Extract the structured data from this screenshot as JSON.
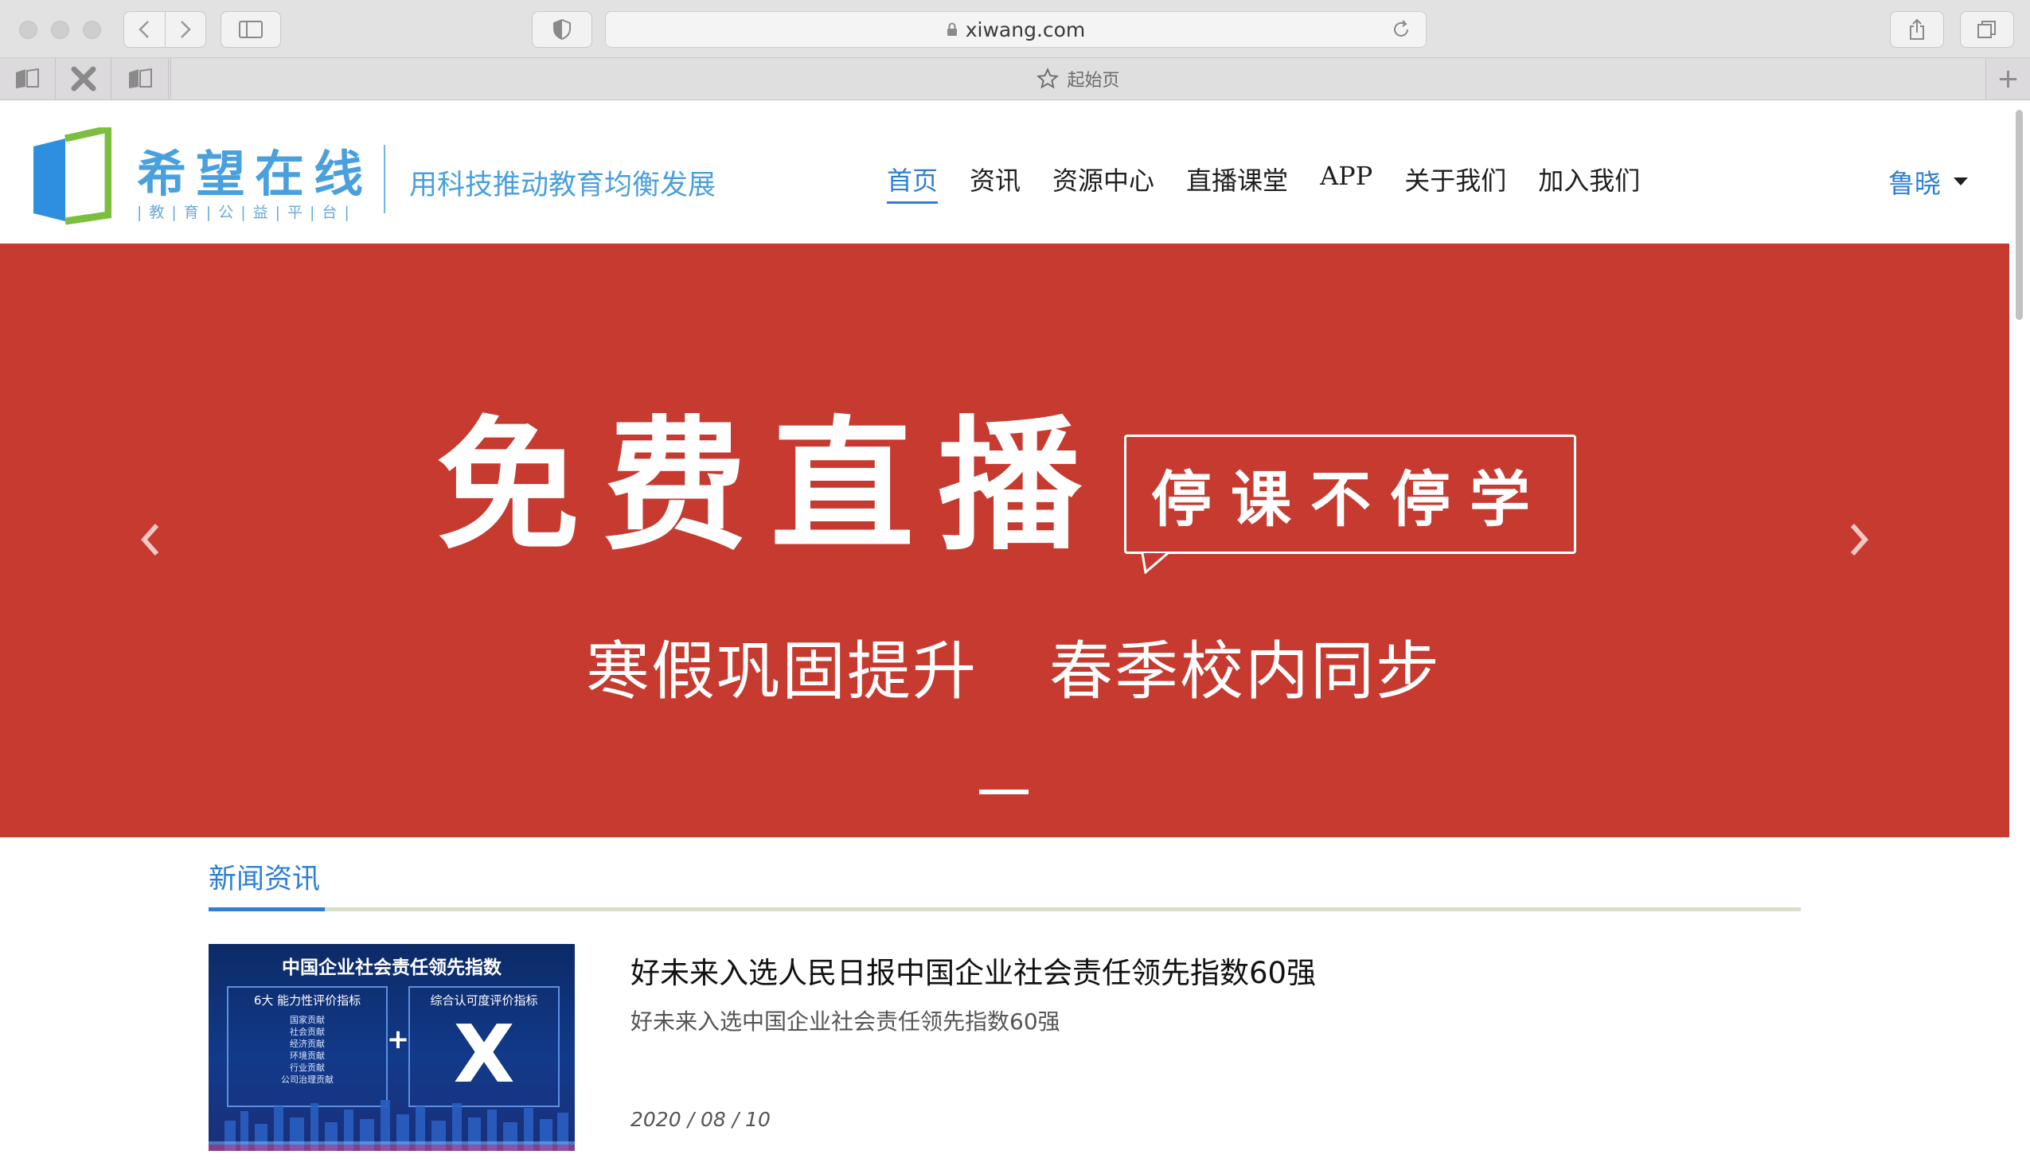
{
  "browser": {
    "address": "xiwang.com",
    "active_tab_title": "起始页",
    "new_tab_symbol": "+"
  },
  "site": {
    "logo_title": "希望在线",
    "logo_subtitle": "|教|育|公|益|平|台|",
    "slogan": "用科技推动教育均衡发展",
    "nav": [
      {
        "label": "首页",
        "active": true
      },
      {
        "label": "资讯",
        "active": false
      },
      {
        "label": "资源中心",
        "active": false
      },
      {
        "label": "直播课堂",
        "active": false
      },
      {
        "label": "APP",
        "active": false
      },
      {
        "label": "关于我们",
        "active": false
      },
      {
        "label": "加入我们",
        "active": false
      }
    ],
    "user_name": "鲁晓"
  },
  "banner": {
    "title": "免费直播",
    "bubble": "停课不停学",
    "sub_left": "寒假巩固提升",
    "sub_right": "春季校内同步"
  },
  "news": {
    "heading": "新闻资讯",
    "items": [
      {
        "title": "好未来入选人民日报中国企业社会责任领先指数60强",
        "summary": "好未来入选中国企业社会责任领先指数60强",
        "date": "2020 / 08 / 10",
        "thumb": {
          "headline": "中国企业社会责任领先指数",
          "left_box_title": "6大 能力性评价指标",
          "left_box_items": [
            "国家贡献",
            "社会贡献",
            "经济贡献",
            "环境贡献",
            "行业贡献",
            "公司治理贡献"
          ],
          "plus": "+",
          "right_box_title": "综合认可度评价指标",
          "right_box_mark": "X"
        }
      }
    ]
  },
  "colors": {
    "brand_blue": "#2e7fd1",
    "banner_red": "#c63a30",
    "logo_green": "#7cbe3d"
  }
}
